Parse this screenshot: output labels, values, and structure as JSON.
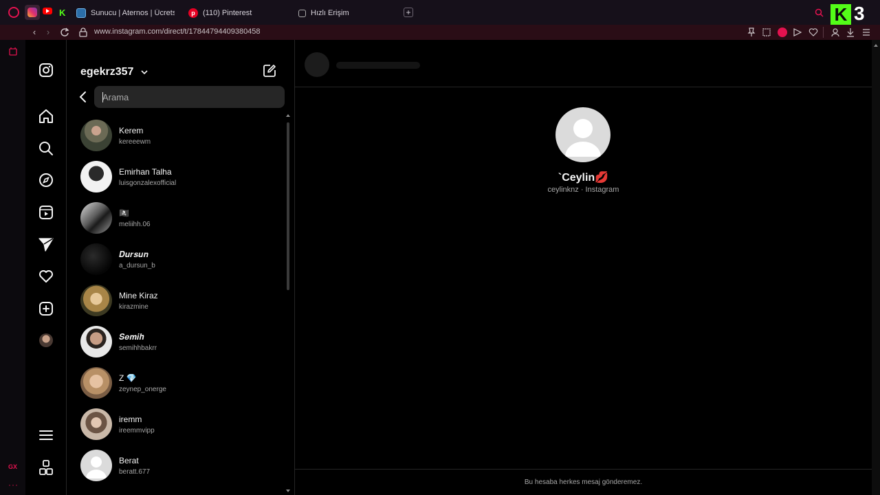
{
  "browser": {
    "tabs": [
      {
        "label": "",
        "icon": "instagram-icon"
      },
      {
        "label": "",
        "icon": "youtube-icon"
      },
      {
        "label": "",
        "icon": "kick-icon"
      },
      {
        "label": "Sunucu | Aternos | Ücrets",
        "icon": "aternos-icon"
      },
      {
        "label": "(110) Pinterest",
        "icon": "pinterest-icon"
      },
      {
        "label": "Hızlı Erişim",
        "icon": "speed-dial-icon"
      }
    ],
    "url": "www.instagram.com/direct/t/17844794409380458",
    "accent_color": "#e3124f",
    "gx_label": "GX",
    "k3_badge": "3"
  },
  "dm": {
    "username": "egekrz357",
    "search_placeholder": "Arama",
    "conversations": [
      {
        "name": "Kerem",
        "username": "kereeewm"
      },
      {
        "name": "Emirhan Talha",
        "username": "luisgonzalexofficial"
      },
      {
        "name": "🏴‍☠️",
        "username": "meliihh.06"
      },
      {
        "name": "𝑫𝒖𝒓𝒔𝒖𝒏",
        "username": "a_dursun_b"
      },
      {
        "name": "Mine Kiraz",
        "username": "kirazmine"
      },
      {
        "name": "𝑺𝒆𝒎𝒊𝒉",
        "username": "semihhbakrr"
      },
      {
        "name": "Z 💎",
        "username": "zeynep_onerge"
      },
      {
        "name": "iremm",
        "username": "ireemmvipp"
      },
      {
        "name": "Berat",
        "username": "beratt.677"
      }
    ]
  },
  "chat": {
    "profile_name": "`Ceylin💋",
    "profile_subtitle": "ceylinknz · Instagram",
    "footer_notice": "Bu hesaba herkes mesaj gönderemez."
  }
}
